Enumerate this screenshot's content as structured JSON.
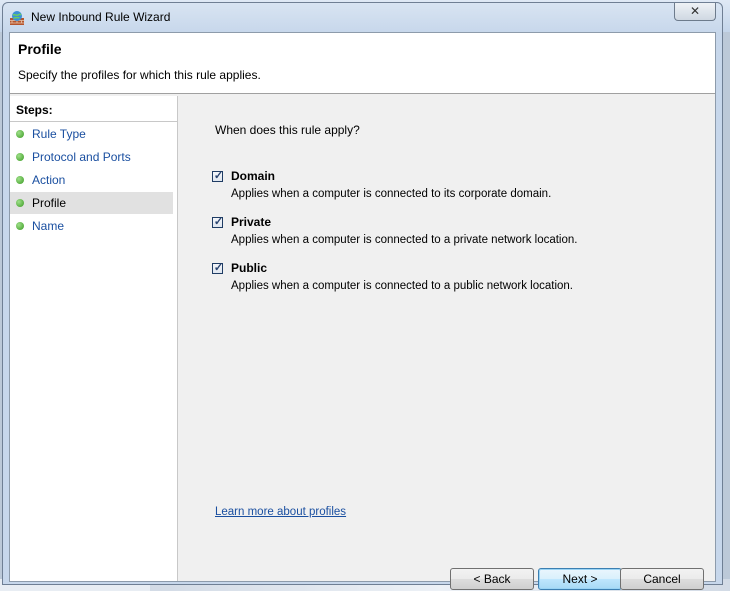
{
  "window": {
    "title": "New Inbound Rule Wizard",
    "close_glyph": "✕"
  },
  "header": {
    "title": "Profile",
    "description": "Specify the profiles for which this rule applies."
  },
  "steps": {
    "title": "Steps:",
    "items": [
      {
        "label": "Rule Type",
        "active": false
      },
      {
        "label": "Protocol and Ports",
        "active": false
      },
      {
        "label": "Action",
        "active": false
      },
      {
        "label": "Profile",
        "active": true
      },
      {
        "label": "Name",
        "active": false
      }
    ]
  },
  "main": {
    "question": "When does this rule apply?",
    "options": [
      {
        "label": "Domain",
        "checked": true,
        "description": "Applies when a computer is connected to its corporate domain."
      },
      {
        "label": "Private",
        "checked": true,
        "description": "Applies when a computer is connected to a private network location."
      },
      {
        "label": "Public",
        "checked": true,
        "description": "Applies when a computer is connected to a public network location."
      }
    ],
    "check_glyph": "✓",
    "learn_more": "Learn more about profiles"
  },
  "buttons": {
    "back": "< Back",
    "next": "Next >",
    "cancel": "Cancel"
  }
}
